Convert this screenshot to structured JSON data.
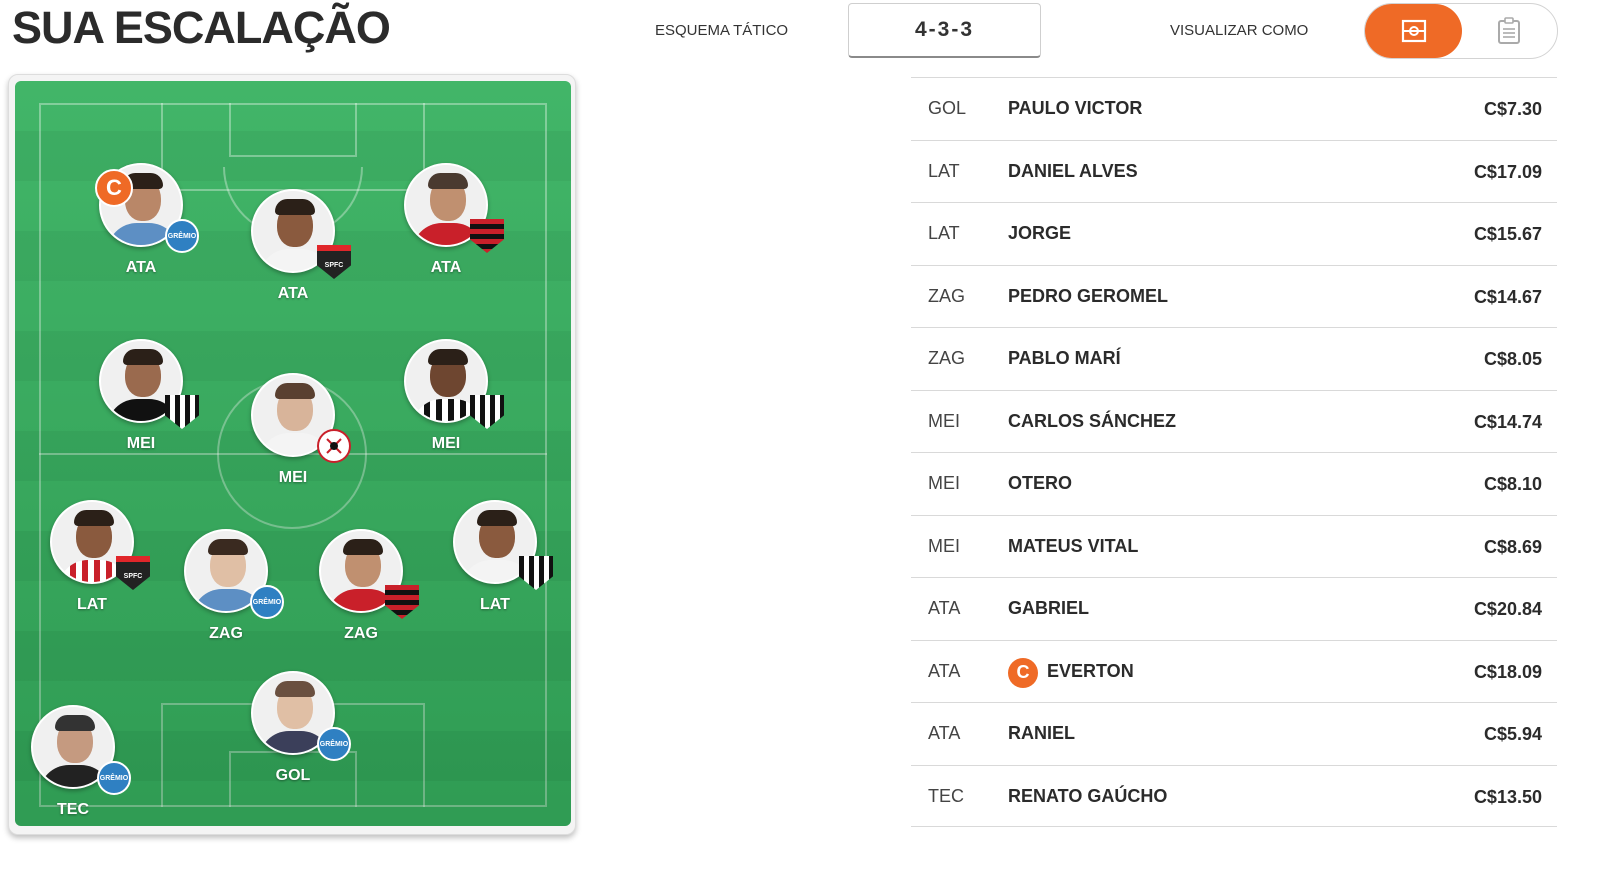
{
  "header": {
    "title": "SUA ESCALAÇÃO",
    "formation_label": "ESQUEMA TÁTICO",
    "formation_value": "4-3-3",
    "view_label": "VISUALIZAR COMO",
    "view_options": [
      {
        "icon": "field-view-icon",
        "active": true
      },
      {
        "icon": "list-view-icon",
        "active": false
      }
    ]
  },
  "colors": {
    "accent": "#ef6a26",
    "field_green": "#36b15f"
  },
  "field": {
    "players": [
      {
        "position": "ATA",
        "club_badge": "gremio",
        "captain": true,
        "captain_mark": "C"
      },
      {
        "position": "ATA",
        "club_badge": "spfc",
        "captain": false
      },
      {
        "position": "ATA",
        "club_badge": "flamengo",
        "captain": false
      },
      {
        "position": "MEI",
        "club_badge": "atletico-mg",
        "captain": false
      },
      {
        "position": "MEI",
        "club_badge": "corinthians",
        "captain": false
      },
      {
        "position": "MEI",
        "club_badge": "santos",
        "captain": false
      },
      {
        "position": "LAT",
        "club_badge": "spfc",
        "captain": false
      },
      {
        "position": "ZAG",
        "club_badge": "gremio",
        "captain": false
      },
      {
        "position": "ZAG",
        "club_badge": "flamengo",
        "captain": false
      },
      {
        "position": "LAT",
        "club_badge": "santos",
        "captain": false
      },
      {
        "position": "GOL",
        "club_badge": "gremio",
        "captain": false
      },
      {
        "position": "TEC",
        "club_badge": "gremio",
        "captain": false
      }
    ],
    "badge_texts": {
      "gremio": "GRÊMIO",
      "spfc": "SPFC"
    }
  },
  "table": {
    "rows": [
      {
        "pos": "GOL",
        "name": "PAULO VICTOR",
        "price": "C$7.30",
        "captain": false
      },
      {
        "pos": "LAT",
        "name": "DANIEL ALVES",
        "price": "C$17.09",
        "captain": false
      },
      {
        "pos": "LAT",
        "name": "JORGE",
        "price": "C$15.67",
        "captain": false
      },
      {
        "pos": "ZAG",
        "name": "PEDRO GEROMEL",
        "price": "C$14.67",
        "captain": false
      },
      {
        "pos": "ZAG",
        "name": "PABLO MARÍ",
        "price": "C$8.05",
        "captain": false
      },
      {
        "pos": "MEI",
        "name": "CARLOS SÁNCHEZ",
        "price": "C$14.74",
        "captain": false
      },
      {
        "pos": "MEI",
        "name": "OTERO",
        "price": "C$8.10",
        "captain": false
      },
      {
        "pos": "MEI",
        "name": "MATEUS VITAL",
        "price": "C$8.69",
        "captain": false
      },
      {
        "pos": "ATA",
        "name": "GABRIEL",
        "price": "C$20.84",
        "captain": false
      },
      {
        "pos": "ATA",
        "name": "EVERTON",
        "price": "C$18.09",
        "captain": true,
        "captain_mark": "C"
      },
      {
        "pos": "ATA",
        "name": "RANIEL",
        "price": "C$5.94",
        "captain": false
      },
      {
        "pos": "TEC",
        "name": "RENATO GAÚCHO",
        "price": "C$13.50",
        "captain": false
      }
    ]
  }
}
